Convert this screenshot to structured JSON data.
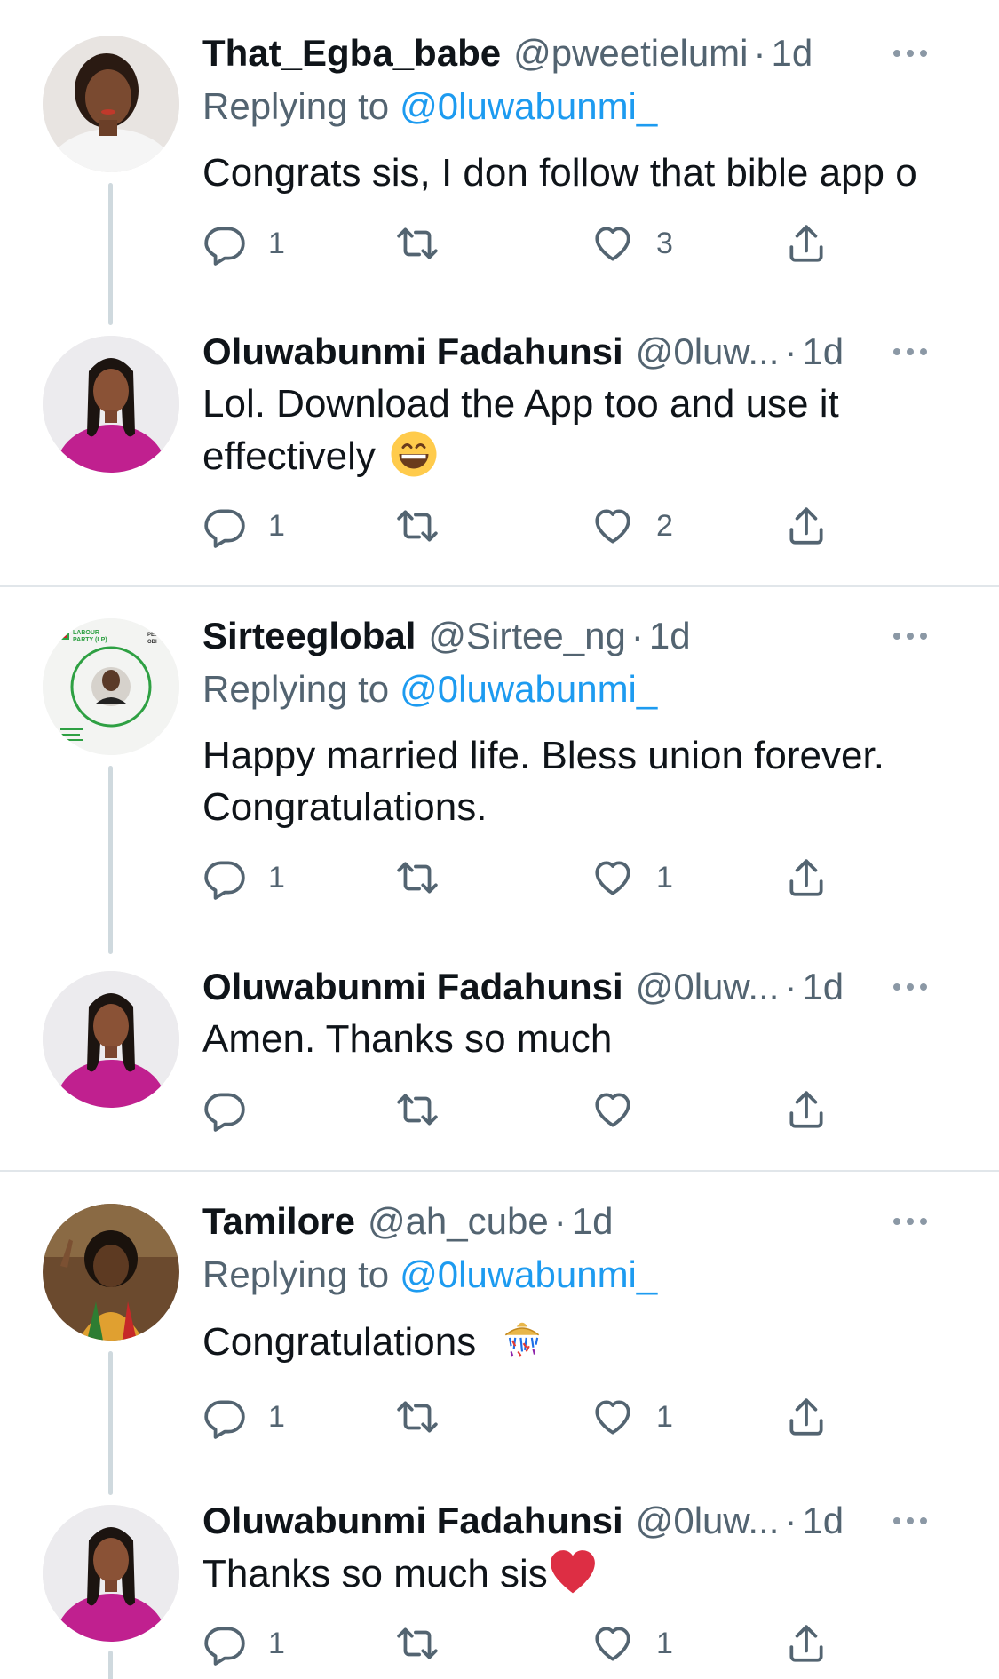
{
  "tweets": [
    {
      "name": "That_Egba_babe",
      "handle": "@pweetielumi",
      "time": "1d",
      "replying_label": "Replying to",
      "replying_mention": "@0luwabunmi_",
      "text": "Congrats sis, I don follow that bible app o",
      "replies": "1",
      "retweets": "",
      "likes": "3",
      "avatar_icon": "profile-photo"
    },
    {
      "name": "Oluwabunmi Fadahunsi",
      "handle": "@0luw...",
      "time": "1d",
      "text": "Lol. Download the App too and use it effectively",
      "emoji": "grinning-face-emoji",
      "replies": "1",
      "retweets": "",
      "likes": "2"
    },
    {
      "name": "Sirteeglobal",
      "handle": "@Sirtee_ng",
      "time": "1d",
      "replying_label": "Replying to",
      "replying_mention": "@0luwabunmi_",
      "text": "Happy married life. Bless union forever. Congratulations.",
      "replies": "1",
      "retweets": "",
      "likes": "1",
      "avatar_text": {
        "line1": "LABOUR",
        "line2": "PARTY (LP)",
        "side1": "M.",
        "side2": "PET",
        "side3": "OBI"
      }
    },
    {
      "name": "Oluwabunmi Fadahunsi",
      "handle": "@0luw...",
      "time": "1d",
      "text": "Amen. Thanks so much",
      "replies": "",
      "retweets": "",
      "likes": ""
    },
    {
      "name": "Tamilore",
      "handle": "@ah_cube",
      "time": "1d",
      "replying_label": "Replying to",
      "replying_mention": "@0luwabunmi_",
      "text": "Congratulations",
      "emoji": "confetti-ball-emoji",
      "replies": "1",
      "retweets": "",
      "likes": "1"
    },
    {
      "name": "Oluwabunmi Fadahunsi",
      "handle": "@0luw...",
      "time": "1d",
      "text": "Thanks so much sis",
      "emoji": "red-heart-emoji",
      "replies": "1",
      "retweets": "",
      "likes": "1"
    }
  ],
  "separator": "·",
  "colors": {
    "mention": "#1d9bf0",
    "secondary_text": "#536471",
    "thread_line": "#cfd9de",
    "divider": "#e1e6ea"
  }
}
